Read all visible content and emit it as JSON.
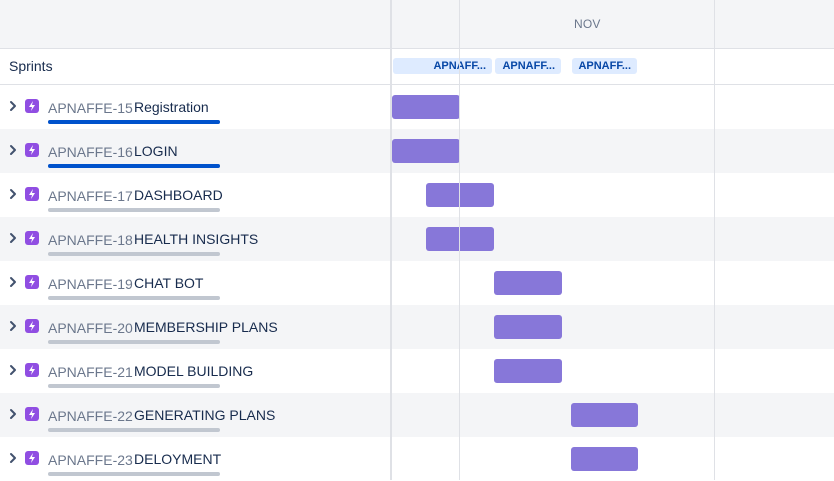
{
  "timeline": {
    "month_label": "NOV",
    "sprints_label": "Sprints",
    "sprint_chips": [
      {
        "label": "APNAFF..."
      },
      {
        "label": "APNAFF..."
      },
      {
        "label": "APNAFF..."
      }
    ]
  },
  "issues": [
    {
      "key": "APNAFFE-15",
      "title": "Registration",
      "progress": 1.0
    },
    {
      "key": "APNAFFE-16",
      "title": "LOGIN",
      "progress": 1.0
    },
    {
      "key": "APNAFFE-17",
      "title": "DASHBOARD",
      "progress": 0.0
    },
    {
      "key": "APNAFFE-18",
      "title": "HEALTH INSIGHTS",
      "progress": 0.0
    },
    {
      "key": "APNAFFE-19",
      "title": "CHAT BOT",
      "progress": 0.0
    },
    {
      "key": "APNAFFE-20",
      "title": "MEMBERSHIP PLANS",
      "progress": 0.0
    },
    {
      "key": "APNAFFE-21",
      "title": "MODEL BUILDING",
      "progress": 0.0
    },
    {
      "key": "APNAFFE-22",
      "title": "GENERATING PLANS",
      "progress": 0.0
    },
    {
      "key": "APNAFFE-23",
      "title": "DELOYMENT",
      "progress": 0.0
    }
  ],
  "colors": {
    "epic_bar": "#8777d9",
    "epic_icon": "#904ee2",
    "progress_done": "#0052cc",
    "progress_track": "#c1c7d0",
    "sprint_chip_bg": "#deebff",
    "sprint_chip_text": "#0747a6"
  }
}
